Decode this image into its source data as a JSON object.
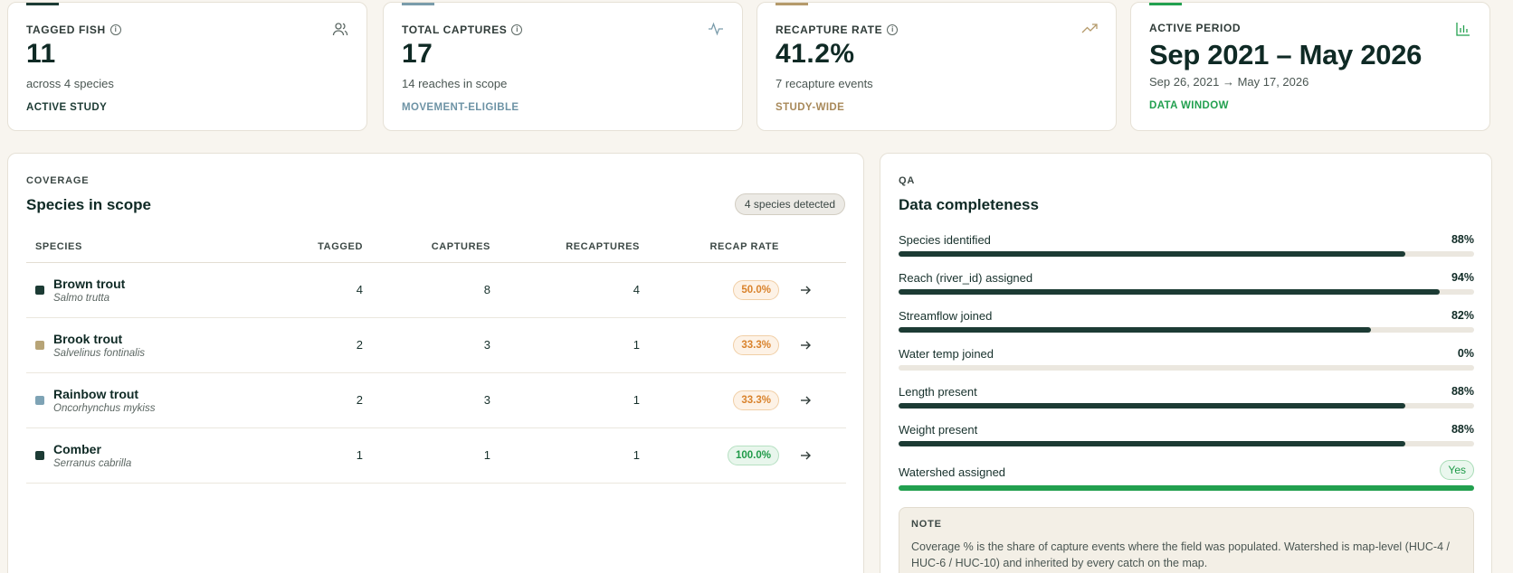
{
  "stats": [
    {
      "label": "TAGGED FISH",
      "value": "11",
      "sub": "across 4 species",
      "tag": "ACTIVE STUDY",
      "accent": "#1c3b34",
      "tag_color": "#1c3b34",
      "icon": "users-icon"
    },
    {
      "label": "TOTAL CAPTURES",
      "value": "17",
      "sub": "14 reaches in scope",
      "tag": "MOVEMENT-ELIGIBLE",
      "accent": "#7a9cab",
      "tag_color": "#6d93a5",
      "icon": "activity-icon"
    },
    {
      "label": "RECAPTURE RATE",
      "value": "41.2%",
      "sub": "7 recapture events",
      "tag": "STUDY-WIDE",
      "accent": "#b59a6b",
      "tag_color": "#a8895a",
      "icon": "trending-up-icon"
    },
    {
      "label": "ACTIVE PERIOD",
      "value": "Sep 2021 – May 2026",
      "sub": "Sep 26, 2021 → May 17, 2026",
      "tag": "DATA WINDOW",
      "accent": "#22a04f",
      "tag_color": "#22a04f",
      "icon": "bar-chart-icon"
    }
  ],
  "coverage": {
    "eyebrow": "COVERAGE",
    "title": "Species in scope",
    "badge": "4 species detected",
    "columns": [
      "SPECIES",
      "TAGGED",
      "CAPTURES",
      "RECAPTURES",
      "RECAP RATE"
    ],
    "rows": [
      {
        "name": "Brown trout",
        "latin": "Salmo trutta",
        "color": "#1c3b34",
        "tagged": "4",
        "captures": "8",
        "recaptures": "4",
        "rate": "50.0%",
        "rate_status": "warn"
      },
      {
        "name": "Brook trout",
        "latin": "Salvelinus fontinalis",
        "color": "#b7a477",
        "tagged": "2",
        "captures": "3",
        "recaptures": "1",
        "rate": "33.3%",
        "rate_status": "warn"
      },
      {
        "name": "Rainbow trout",
        "latin": "Oncorhynchus mykiss",
        "color": "#7ea3b5",
        "tagged": "2",
        "captures": "3",
        "recaptures": "1",
        "rate": "33.3%",
        "rate_status": "warn"
      },
      {
        "name": "Comber",
        "latin": "Serranus cabrilla",
        "color": "#1c3b34",
        "tagged": "1",
        "captures": "1",
        "recaptures": "1",
        "rate": "100.0%",
        "rate_status": "good"
      }
    ]
  },
  "qa": {
    "eyebrow": "QA",
    "title": "Data completeness",
    "items": [
      {
        "label": "Species identified",
        "value": "88%",
        "pct": 88
      },
      {
        "label": "Reach (river_id) assigned",
        "value": "94%",
        "pct": 94
      },
      {
        "label": "Streamflow joined",
        "value": "82%",
        "pct": 82
      },
      {
        "label": "Water temp joined",
        "value": "0%",
        "pct": 0
      },
      {
        "label": "Length present",
        "value": "88%",
        "pct": 88
      },
      {
        "label": "Weight present",
        "value": "88%",
        "pct": 88
      }
    ],
    "watershed": {
      "label": "Watershed assigned",
      "value": "Yes",
      "pct": 100,
      "color": "#22a04f"
    },
    "note_title": "NOTE",
    "note_body": "Coverage % is the share of capture events where the field was populated. Watershed is map-level (HUC-4 / HUC-6 / HUC-10) and inherited by every catch on the map."
  }
}
